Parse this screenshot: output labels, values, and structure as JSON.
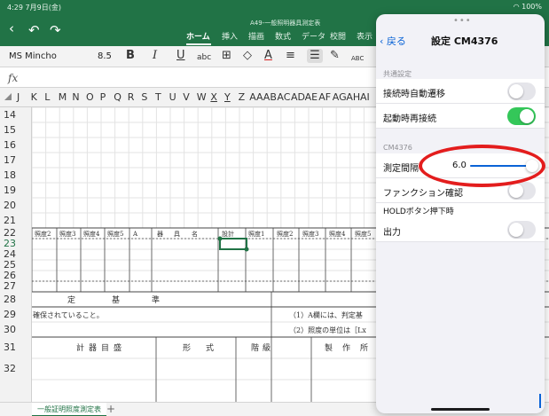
{
  "status": {
    "time": "4:29",
    "date": "7月9日(金)",
    "battery": "100%"
  },
  "document": {
    "title": "A49-一般照明器具測定表"
  },
  "ribbon": {
    "tabs": [
      "ホーム",
      "挿入",
      "描画",
      "数式",
      "データ",
      "校閲",
      "表示"
    ],
    "active_tab": "ホーム"
  },
  "toolbar": {
    "font_name": "MS Mincho",
    "font_size": "8.5",
    "bold": "B",
    "italic": "I",
    "underline": "U",
    "strikethrough": "abc",
    "font_color_letter": "A",
    "more_label": "ABC"
  },
  "formula_bar": {
    "fx": "fx",
    "value": ""
  },
  "columns": [
    "J",
    "K",
    "L",
    "M",
    "N",
    "O",
    "P",
    "Q",
    "R",
    "S",
    "T",
    "U",
    "V",
    "W",
    "X",
    "Y",
    "Z",
    "AA",
    "AB",
    "AC",
    "AD",
    "AE",
    "AF",
    "AG",
    "AH",
    "AI"
  ],
  "rows": [
    "14",
    "15",
    "16",
    "17",
    "18",
    "19",
    "20",
    "21",
    "22",
    "23",
    "24",
    "25",
    "26",
    "27",
    "28",
    "29",
    "30",
    "31",
    "32"
  ],
  "sheet": {
    "row22_headers": [
      "照度2",
      "照度3",
      "照度4",
      "照度5",
      "A",
      "器",
      "具",
      "名",
      "設計",
      "照度1",
      "照度2",
      "照度3",
      "照度4",
      "照度5"
    ],
    "row28_text": [
      "定",
      "基",
      "準"
    ],
    "row29_left": "確保されていること。",
    "row29_right": "（1）A欄には、判定基",
    "row30_right": "（2）照度の単位は［Lx",
    "row31_headers": [
      "計",
      "器",
      "目",
      "盛",
      "形",
      "式",
      "階",
      "級",
      "製",
      "作",
      "所"
    ],
    "tab_name": "一般証明照度測定表",
    "add_sheet": "+"
  },
  "panel": {
    "back_label": "戻る",
    "title": "設定 CM4376",
    "section_common": "共通設定",
    "auto_transition_label": "接続時自動遷移",
    "auto_transition_on": false,
    "auto_connect_label": "起動時再接続",
    "auto_connect_on": true,
    "section_device": "CM4376",
    "interval_label": "測定間隔",
    "interval_value": "6.0",
    "interval_fraction": 1.0,
    "function_check_label": "ファンクション確認",
    "function_check_on": false,
    "hold_section": "HOLDボタン押下時",
    "output_label": "出力",
    "output_on": false
  },
  "colors": {
    "excel_green": "#217346",
    "ios_blue": "#0a63d6",
    "toggle_on": "#34c759",
    "highlight_red": "#e31d1d"
  }
}
